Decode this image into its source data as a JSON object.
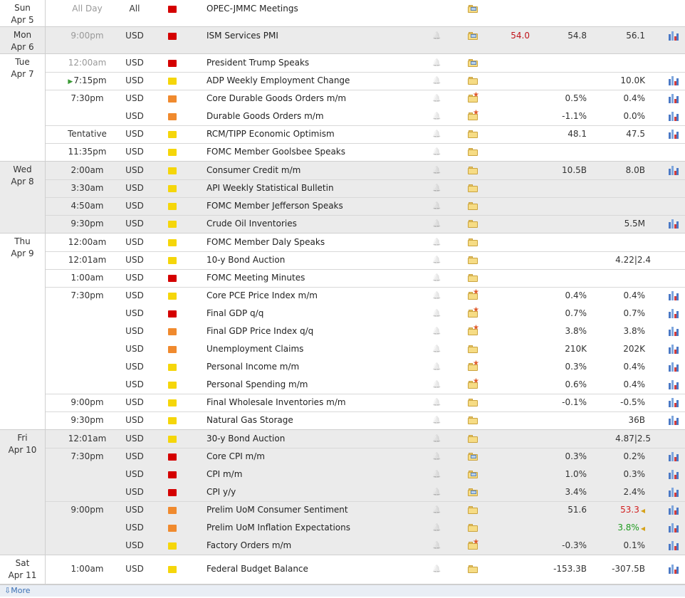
{
  "calendar": {
    "days": [
      {
        "day": "Sun",
        "date": "Apr 5",
        "alt": false,
        "events": [
          {
            "time": "All Day",
            "time_dim": true,
            "currency": "All",
            "impact": "high",
            "title": "OPEC-JMMC Meetings",
            "bell": false,
            "folder": "doc",
            "actual": "",
            "forecast": "",
            "previous": "",
            "graph": false
          }
        ]
      },
      {
        "day": "Mon",
        "date": "Apr 6",
        "alt": true,
        "events": [
          {
            "time": "9:00pm",
            "time_dim": true,
            "currency": "USD",
            "impact": "high",
            "title": "ISM Services PMI",
            "bell": true,
            "folder": "doc",
            "actual": "54.0",
            "forecast": "54.8",
            "previous": "56.1",
            "graph": true
          }
        ]
      },
      {
        "day": "Tue",
        "date": "Apr 7",
        "alt": false,
        "events": [
          {
            "time": "12:00am",
            "time_dim": true,
            "currency": "USD",
            "impact": "high",
            "title": "President Trump Speaks",
            "bell": true,
            "folder": "doc",
            "actual": "",
            "forecast": "",
            "previous": "",
            "graph": false,
            "sep": false
          },
          {
            "time": "7:15pm",
            "time_dim": false,
            "next": true,
            "currency": "USD",
            "impact": "low",
            "title": "ADP Weekly Employment Change",
            "bell": true,
            "folder": "plain",
            "actual": "",
            "forecast": "",
            "previous": "10.0K",
            "graph": true,
            "sep": true
          },
          {
            "time": "7:30pm",
            "time_dim": false,
            "currency": "USD",
            "impact": "med",
            "title": "Core Durable Goods Orders m/m",
            "bell": true,
            "folder": "star",
            "actual": "",
            "forecast": "0.5%",
            "previous": "0.4%",
            "graph": true,
            "sep": true
          },
          {
            "time": "",
            "currency": "USD",
            "impact": "med",
            "title": "Durable Goods Orders m/m",
            "bell": true,
            "folder": "star",
            "actual": "",
            "forecast": "-1.1%",
            "previous": "0.0%",
            "graph": true,
            "sep": false
          },
          {
            "time": "Tentative",
            "time_dim": false,
            "currency": "USD",
            "impact": "low",
            "title": "RCM/TIPP Economic Optimism",
            "bell": true,
            "folder": "plain",
            "actual": "",
            "forecast": "48.1",
            "previous": "47.5",
            "graph": true,
            "sep": true
          },
          {
            "time": "11:35pm",
            "time_dim": false,
            "currency": "USD",
            "impact": "low",
            "title": "FOMC Member Goolsbee Speaks",
            "bell": true,
            "folder": "plain",
            "actual": "",
            "forecast": "",
            "previous": "",
            "graph": false,
            "sep": true
          }
        ]
      },
      {
        "day": "Wed",
        "date": "Apr 8",
        "alt": true,
        "events": [
          {
            "time": "2:00am",
            "time_dim": false,
            "currency": "USD",
            "impact": "low",
            "title": "Consumer Credit m/m",
            "bell": true,
            "folder": "plain",
            "actual": "",
            "forecast": "10.5B",
            "previous": "8.0B",
            "graph": true,
            "sep": false
          },
          {
            "time": "3:30am",
            "time_dim": false,
            "currency": "USD",
            "impact": "low",
            "title": "API Weekly Statistical Bulletin",
            "bell": true,
            "folder": "plain",
            "actual": "",
            "forecast": "",
            "previous": "",
            "graph": false,
            "sep": true
          },
          {
            "time": "4:50am",
            "time_dim": false,
            "currency": "USD",
            "impact": "low",
            "title": "FOMC Member Jefferson Speaks",
            "bell": true,
            "folder": "plain",
            "actual": "",
            "forecast": "",
            "previous": "",
            "graph": false,
            "sep": true
          },
          {
            "time": "9:30pm",
            "time_dim": false,
            "currency": "USD",
            "impact": "low",
            "title": "Crude Oil Inventories",
            "bell": true,
            "folder": "plain",
            "actual": "",
            "forecast": "",
            "previous": "5.5M",
            "graph": true,
            "sep": true
          }
        ]
      },
      {
        "day": "Thu",
        "date": "Apr 9",
        "alt": false,
        "events": [
          {
            "time": "12:00am",
            "time_dim": false,
            "currency": "USD",
            "impact": "low",
            "title": "FOMC Member Daly Speaks",
            "bell": true,
            "folder": "plain",
            "actual": "",
            "forecast": "",
            "previous": "",
            "graph": false,
            "sep": false
          },
          {
            "time": "12:01am",
            "time_dim": false,
            "currency": "USD",
            "impact": "low",
            "title": "10-y Bond Auction",
            "bell": true,
            "folder": "plain",
            "actual": "",
            "forecast": "",
            "previous": "4.22|2.4",
            "graph": false,
            "wide": true,
            "sep": true
          },
          {
            "time": "1:00am",
            "time_dim": false,
            "currency": "USD",
            "impact": "high",
            "title": "FOMC Meeting Minutes",
            "bell": true,
            "folder": "plain",
            "actual": "",
            "forecast": "",
            "previous": "",
            "graph": false,
            "sep": true
          },
          {
            "time": "7:30pm",
            "time_dim": false,
            "currency": "USD",
            "impact": "low",
            "title": "Core PCE Price Index m/m",
            "bell": true,
            "folder": "star",
            "actual": "",
            "forecast": "0.4%",
            "previous": "0.4%",
            "graph": true,
            "sep": true
          },
          {
            "time": "",
            "currency": "USD",
            "impact": "high",
            "title": "Final GDP q/q",
            "bell": true,
            "folder": "star",
            "actual": "",
            "forecast": "0.7%",
            "previous": "0.7%",
            "graph": true,
            "sep": false
          },
          {
            "time": "",
            "currency": "USD",
            "impact": "med",
            "title": "Final GDP Price Index q/q",
            "bell": true,
            "folder": "star",
            "actual": "",
            "forecast": "3.8%",
            "previous": "3.8%",
            "graph": true,
            "sep": false
          },
          {
            "time": "",
            "currency": "USD",
            "impact": "med",
            "title": "Unemployment Claims",
            "bell": true,
            "folder": "plain",
            "actual": "",
            "forecast": "210K",
            "previous": "202K",
            "graph": true,
            "sep": false
          },
          {
            "time": "",
            "currency": "USD",
            "impact": "low",
            "title": "Personal Income m/m",
            "bell": true,
            "folder": "star",
            "actual": "",
            "forecast": "0.3%",
            "previous": "0.4%",
            "graph": true,
            "sep": false
          },
          {
            "time": "",
            "currency": "USD",
            "impact": "low",
            "title": "Personal Spending m/m",
            "bell": true,
            "folder": "star",
            "actual": "",
            "forecast": "0.6%",
            "previous": "0.4%",
            "graph": true,
            "sep": false
          },
          {
            "time": "9:00pm",
            "time_dim": false,
            "currency": "USD",
            "impact": "low",
            "title": "Final Wholesale Inventories m/m",
            "bell": true,
            "folder": "plain",
            "actual": "",
            "forecast": "-0.1%",
            "previous": "-0.5%",
            "graph": true,
            "sep": true
          },
          {
            "time": "9:30pm",
            "time_dim": false,
            "currency": "USD",
            "impact": "low",
            "title": "Natural Gas Storage",
            "bell": true,
            "folder": "plain",
            "actual": "",
            "forecast": "",
            "previous": "36B",
            "graph": true,
            "sep": true
          }
        ]
      },
      {
        "day": "Fri",
        "date": "Apr 10",
        "alt": true,
        "events": [
          {
            "time": "12:01am",
            "time_dim": false,
            "currency": "USD",
            "impact": "low",
            "title": "30-y Bond Auction",
            "bell": true,
            "folder": "plain",
            "actual": "",
            "forecast": "",
            "previous": "4.87|2.5",
            "graph": false,
            "wide": true,
            "sep": false
          },
          {
            "time": "7:30pm",
            "time_dim": false,
            "currency": "USD",
            "impact": "high",
            "title": "Core CPI m/m",
            "bell": true,
            "folder": "doc",
            "actual": "",
            "forecast": "0.3%",
            "previous": "0.2%",
            "graph": true,
            "sep": true
          },
          {
            "time": "",
            "currency": "USD",
            "impact": "high",
            "title": "CPI m/m",
            "bell": true,
            "folder": "doc",
            "actual": "",
            "forecast": "1.0%",
            "previous": "0.3%",
            "graph": true,
            "sep": false
          },
          {
            "time": "",
            "currency": "USD",
            "impact": "high",
            "title": "CPI y/y",
            "bell": true,
            "folder": "doc",
            "actual": "",
            "forecast": "3.4%",
            "previous": "2.4%",
            "graph": true,
            "sep": false
          },
          {
            "time": "9:00pm",
            "time_dim": false,
            "currency": "USD",
            "impact": "med",
            "title": "Prelim UoM Consumer Sentiment",
            "bell": true,
            "folder": "plain",
            "actual": "",
            "forecast": "51.6",
            "previous": "53.3",
            "previous_color": "red",
            "revised": true,
            "graph": true,
            "sep": true
          },
          {
            "time": "",
            "currency": "USD",
            "impact": "med",
            "title": "Prelim UoM Inflation Expectations",
            "bell": true,
            "folder": "plain",
            "actual": "",
            "forecast": "",
            "previous": "3.8%",
            "previous_color": "green",
            "revised": true,
            "graph": true,
            "sep": false
          },
          {
            "time": "",
            "currency": "USD",
            "impact": "low",
            "title": "Factory Orders m/m",
            "bell": true,
            "folder": "star",
            "actual": "",
            "forecast": "-0.3%",
            "previous": "0.1%",
            "graph": true,
            "sep": false
          }
        ]
      },
      {
        "day": "Sat",
        "date": "Apr 11",
        "alt": false,
        "tall": true,
        "events": [
          {
            "time": "1:00am",
            "time_dim": false,
            "currency": "USD",
            "impact": "low",
            "title": "Federal Budget Balance",
            "bell": true,
            "folder": "plain",
            "actual": "",
            "forecast": "-153.3B",
            "previous": "-307.5B",
            "graph": true,
            "sep": false
          }
        ]
      }
    ],
    "more_label": "More",
    "icons": {
      "bell": "bell-icon",
      "folder": "folder-icon",
      "graph": "graph-icon",
      "next": "play-arrow-icon",
      "more": "down-arrow-icon"
    },
    "colors": {
      "high": "#d40000",
      "med": "#f08a2e",
      "low": "#f5d60a",
      "actual": "#c0141b",
      "better": "#1f9b1f",
      "worse": "#d21f1f"
    }
  }
}
